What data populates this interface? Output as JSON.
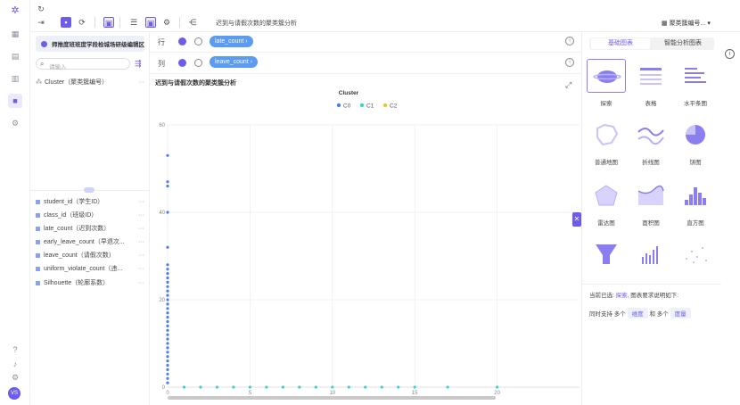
{
  "toolbar": {
    "title": "迟到与请假次数的聚类簇分析",
    "dataset_label": "聚类簇编号..."
  },
  "left_panel": {
    "dataset_name": "师推度班班度学段检城场研级编辑区",
    "search_placeholder": "请输入",
    "dimensions": [
      {
        "label": "Cluster（聚类簇编号）"
      }
    ],
    "measures": [
      {
        "label": "student_id（学生ID）"
      },
      {
        "label": "class_id（班级ID）"
      },
      {
        "label": "late_count（迟到次数）"
      },
      {
        "label": "early_leave_count（早退次..."
      },
      {
        "label": "leave_count（请假次数）"
      },
      {
        "label": "uniform_violate_count（违..."
      },
      {
        "label": "Silhouette（轮廓系数）"
      }
    ]
  },
  "shelves": {
    "row_label": "行",
    "row_field": "late_count",
    "col_label": "列",
    "col_field": "leave_count"
  },
  "chart_data": {
    "type": "scatter",
    "title": "迟到与请假次数的聚类簇分析",
    "legend_title": "Cluster",
    "legend_position": "top-center",
    "xlim": [
      0,
      25
    ],
    "ylim": [
      0,
      60
    ],
    "x_ticks": [
      0,
      5,
      10,
      15,
      20
    ],
    "y_ticks": [
      0,
      20,
      40,
      60
    ],
    "grid": true,
    "series": [
      {
        "name": "C0",
        "color": "#4f7ee8",
        "points": [
          [
            0,
            53
          ],
          [
            0,
            47
          ],
          [
            0,
            46
          ],
          [
            0,
            40
          ],
          [
            0,
            32
          ],
          [
            0,
            28
          ],
          [
            0,
            27
          ],
          [
            0,
            26
          ],
          [
            0,
            25
          ],
          [
            0,
            24
          ],
          [
            0,
            23
          ],
          [
            0,
            22
          ],
          [
            0,
            21
          ],
          [
            0,
            20
          ],
          [
            0,
            19
          ],
          [
            0,
            18
          ],
          [
            0,
            17
          ],
          [
            0,
            16
          ],
          [
            0,
            15
          ],
          [
            0,
            14
          ],
          [
            0,
            13
          ],
          [
            0,
            12
          ],
          [
            0,
            11
          ],
          [
            0,
            10
          ],
          [
            0,
            9
          ],
          [
            0,
            8
          ],
          [
            0,
            7
          ],
          [
            0,
            6
          ],
          [
            0,
            5
          ],
          [
            0,
            4
          ],
          [
            0,
            3
          ],
          [
            0,
            2
          ],
          [
            0,
            1
          ]
        ]
      },
      {
        "name": "C1",
        "color": "#3fd0c9",
        "points": [
          [
            1,
            0
          ],
          [
            2,
            0
          ],
          [
            3,
            0
          ],
          [
            4,
            0
          ],
          [
            5,
            0
          ],
          [
            6,
            0
          ],
          [
            7,
            0
          ],
          [
            8,
            0
          ],
          [
            9,
            0
          ],
          [
            10,
            0
          ],
          [
            11,
            0
          ],
          [
            12,
            0
          ],
          [
            13,
            0
          ],
          [
            14,
            0
          ],
          [
            15,
            0
          ],
          [
            17,
            0
          ],
          [
            20,
            0
          ]
        ]
      },
      {
        "name": "C2",
        "color": "#f2c230",
        "points": []
      }
    ]
  },
  "right_panel": {
    "tab_basic": "基础图表",
    "tab_smart": "智能分析图表",
    "charts": [
      {
        "label": "探索"
      },
      {
        "label": "表格"
      },
      {
        "label": "水平条图"
      },
      {
        "label": "普通地图"
      },
      {
        "label": "折线图"
      },
      {
        "label": "饼图"
      },
      {
        "label": "雷达图"
      },
      {
        "label": "面积图"
      },
      {
        "label": "直方图"
      },
      {
        "label": ""
      },
      {
        "label": ""
      },
      {
        "label": ""
      }
    ],
    "current_prefix": "当前已选:",
    "current_chart": "探索",
    "current_suffix": ", 图表要求说明如下:",
    "req_prefix": "同时支持 多个",
    "req_dim": "维度",
    "req_mid": "和 多个",
    "req_measure": "度量"
  },
  "colors": {
    "accent": "#6c5ce7",
    "pill": "#5b9bf2"
  }
}
